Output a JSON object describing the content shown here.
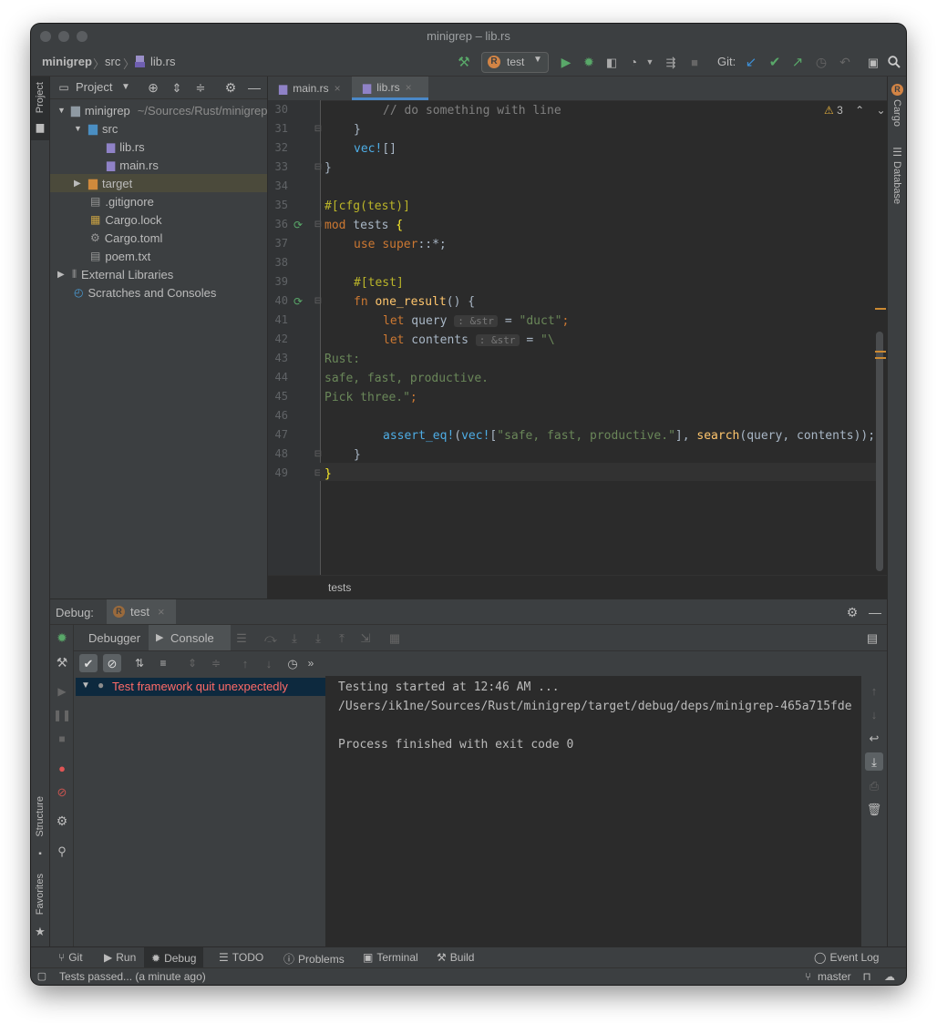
{
  "window": {
    "title": "minigrep – lib.rs"
  },
  "navbar": {
    "breadcrumb": [
      "minigrep",
      "src",
      "lib.rs"
    ],
    "run_config": "test",
    "git_label": "Git:"
  },
  "left_strip": {
    "project": "Project",
    "structure": "Structure",
    "favorites": "Favorites"
  },
  "right_strip": {
    "cargo": "Cargo",
    "database": "Database"
  },
  "project_panel": {
    "title": "Project",
    "tree": [
      {
        "name": "minigrep",
        "path": "~/Sources/Rust/minigrep"
      },
      {
        "name": "src"
      },
      {
        "name": "lib.rs"
      },
      {
        "name": "main.rs"
      },
      {
        "name": "target"
      },
      {
        "name": ".gitignore"
      },
      {
        "name": "Cargo.lock"
      },
      {
        "name": "Cargo.toml"
      },
      {
        "name": "poem.txt"
      },
      {
        "name": "External Libraries"
      },
      {
        "name": "Scratches and Consoles"
      }
    ]
  },
  "editor": {
    "tabs": [
      {
        "label": "main.rs"
      },
      {
        "label": "lib.rs"
      }
    ],
    "warning_count": "3",
    "line_numbers": [
      "30",
      "31",
      "32",
      "33",
      "34",
      "35",
      "36",
      "37",
      "38",
      "39",
      "40",
      "41",
      "42",
      "43",
      "44",
      "45",
      "46",
      "47",
      "48",
      "49"
    ],
    "code": {
      "l30": "// do something with line",
      "l31": "}",
      "l32a": "vec!",
      "l32b": "[]",
      "l33": "}",
      "l35": "#[cfg(test)]",
      "l36a": "mod",
      "l36b": " tests ",
      "l36c": "{",
      "l37a": "use",
      "l37b": " ",
      "l37c": "super",
      "l37d": "::*;",
      "l39": "#[test]",
      "l40a": "fn",
      "l40b": " ",
      "l40c": "one_result",
      "l40d": "() {",
      "l41a": "let",
      "l41b": " query ",
      "l41hint": ": &str",
      "l41c": " = ",
      "l41d": "\"duct\"",
      "l41e": ";",
      "l42a": "let",
      "l42b": " contents ",
      "l42hint": ": &str",
      "l42c": " = ",
      "l42d": "\"\\",
      "l43": "Rust:",
      "l44": "safe, fast, productive.",
      "l45a": "Pick three.\"",
      "l45b": ";",
      "l47a": "assert_eq!",
      "l47b": "(",
      "l47c": "vec!",
      "l47d": "[",
      "l47e": "\"safe, fast, productive.\"",
      "l47f": "], ",
      "l47g": "search",
      "l47h": "(query, contents));",
      "l48": "}",
      "l49": "}"
    },
    "breadcrumb": "tests"
  },
  "debug_panel": {
    "title": "Debug:",
    "config_tab": "test",
    "tabs": {
      "debugger": "Debugger",
      "console": "Console"
    },
    "test_item": "Test framework quit unexpectedly",
    "console_lines": [
      "Testing started at 12:46 AM ...",
      "/Users/ik1ne/Sources/Rust/minigrep/target/debug/deps/minigrep-465a715fde",
      "",
      "Process finished with exit code 0"
    ]
  },
  "toolwindow_bar": {
    "git": "Git",
    "run": "Run",
    "debug": "Debug",
    "todo": "TODO",
    "problems": "Problems",
    "terminal": "Terminal",
    "build": "Build",
    "event_log": "Event Log"
  },
  "status_bar": {
    "message": "Tests passed... (a minute ago)",
    "branch": "master"
  },
  "colors": {
    "accent": "#4a88c7",
    "run_green": "#59a869",
    "error_red": "#ff6b68",
    "keyword": "#cc7832",
    "string": "#6a8759",
    "function": "#ffc66d"
  }
}
